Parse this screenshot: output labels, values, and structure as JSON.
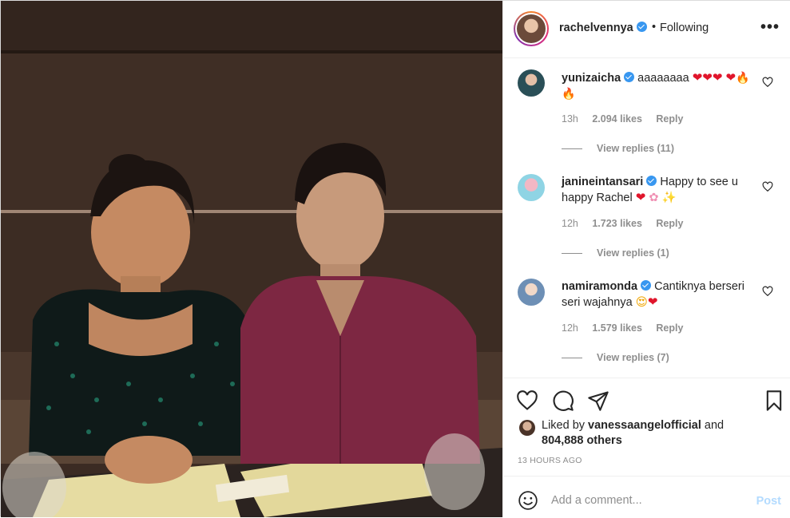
{
  "post": {
    "author": "rachelvennya",
    "follow_separator": "•",
    "follow_status": "Following",
    "more_icon": "more-horizontal-icon"
  },
  "comments": [
    {
      "username": "yunizaicha",
      "text": "aaaaaaaa",
      "emojis": [
        "heart",
        "heart",
        "heart",
        "heart",
        "fire",
        "fire"
      ],
      "time": "13h",
      "likes": "2.094 likes",
      "reply": "Reply",
      "view_replies": "View replies (11)"
    },
    {
      "username": "janineintansari",
      "text": "Happy to see u happy Rachel",
      "emojis": [
        "heart",
        "cherry-blossom",
        "sparkles"
      ],
      "time": "12h",
      "likes": "1.723 likes",
      "reply": "Reply",
      "view_replies": "View replies (1)"
    },
    {
      "username": "namiramonda",
      "text": "Cantiknya berseri seri wajahnya",
      "emojis": [
        "heart-eyes",
        "heart"
      ],
      "time": "12h",
      "likes": "1.579 likes",
      "reply": "Reply",
      "view_replies": "View replies (7)"
    }
  ],
  "liked_by": {
    "prefix": "Liked by",
    "user": "vanessaangelofficial",
    "and": "and",
    "others": "804,888 others"
  },
  "timestamp": "13 HOURS AGO",
  "composer": {
    "placeholder": "Add a comment...",
    "post_label": "Post"
  },
  "colors": {
    "verified": "#3897f0",
    "post_disabled": "#b3dbff",
    "heart": "#e0152b"
  }
}
